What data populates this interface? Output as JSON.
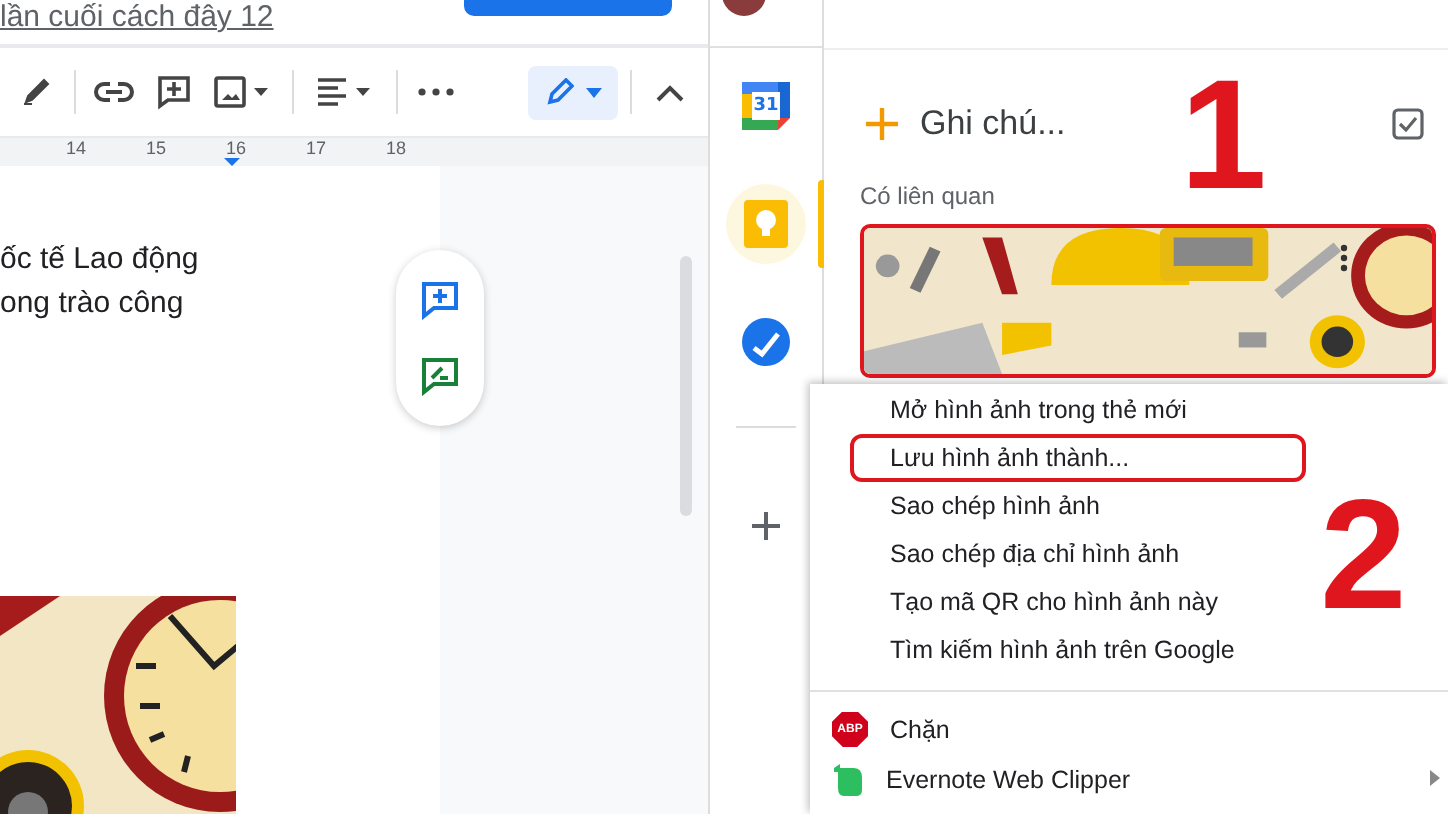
{
  "document": {
    "revision_link": "lần cuối cách đây 12",
    "toolbar": {
      "editing_mode_active": true
    },
    "ruler": {
      "ticks": [
        "14",
        "15",
        "16",
        "17",
        "18"
      ]
    },
    "body_lines": [
      "ốc tế Lao động",
      "ong trào công"
    ]
  },
  "app_rail": [
    {
      "kind": "calendar",
      "label": "31",
      "selected": false
    },
    {
      "kind": "keep",
      "selected": true
    },
    {
      "kind": "tasks",
      "selected": false
    },
    {
      "kind": "add",
      "selected": false
    }
  ],
  "keep_panel": {
    "placeholder": "Ghi chú...",
    "section": "Có liên quan",
    "card": {
      "kind": "picture",
      "annotated": true
    }
  },
  "context_menu": {
    "items": [
      {
        "label": "Mở hình ảnh trong thẻ mới",
        "annotated": false
      },
      {
        "label": "Lưu hình ảnh thành...",
        "annotated": true
      },
      {
        "label": "Sao chép hình ảnh",
        "annotated": false
      },
      {
        "label": "Sao chép địa chỉ hình ảnh",
        "annotated": false
      },
      {
        "label": "Tạo mã QR cho hình ảnh này",
        "annotated": false
      },
      {
        "label": "Tìm kiếm hình ảnh trên Google",
        "annotated": false
      }
    ],
    "extensions": [
      {
        "kind": "adblock",
        "label": "Chặn",
        "badge": "ABP",
        "submenu": false
      },
      {
        "kind": "evernote",
        "label": "Evernote Web Clipper",
        "submenu": true
      }
    ]
  },
  "annotations": [
    {
      "label": "1"
    },
    {
      "label": "2"
    }
  ]
}
